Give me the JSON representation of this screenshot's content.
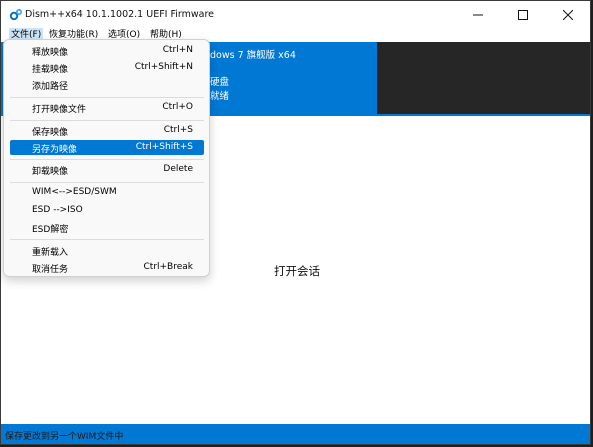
{
  "window": {
    "title": "Dism++x64 10.1.1002.1 UEFI Firmware",
    "app_icon": "gears-icon",
    "controls": [
      "minimize-icon",
      "maximize-icon",
      "close-icon"
    ]
  },
  "menubar": {
    "items": [
      {
        "label": "文件(F)"
      },
      {
        "label": "恢复功能(R)"
      },
      {
        "label": "选项(O)"
      },
      {
        "label": "帮助(H)"
      }
    ]
  },
  "header": {
    "os_name": "dows 7 旗舰版 x64",
    "drive": "硬盘",
    "status": "就绪"
  },
  "main": {
    "center_text": "打开会话"
  },
  "file_menu": {
    "groups": [
      [
        {
          "label": "释放映像",
          "shortcut": "Ctrl+N"
        },
        {
          "label": "挂载映像",
          "shortcut": "Ctrl+Shift+N"
        },
        {
          "label": "添加路径",
          "shortcut": ""
        }
      ],
      [
        {
          "label": "打开映像文件",
          "shortcut": "Ctrl+O"
        }
      ],
      [
        {
          "label": "保存映像",
          "shortcut": "Ctrl+S"
        },
        {
          "label": "另存为映像",
          "shortcut": "Ctrl+Shift+S"
        }
      ],
      [
        {
          "label": "卸载映像",
          "shortcut": "Delete"
        }
      ],
      [
        {
          "label": "WIM<-->ESD/SWM",
          "shortcut": ""
        },
        {
          "label": "ESD -->ISO",
          "shortcut": ""
        },
        {
          "label": "ESD解密",
          "shortcut": ""
        }
      ],
      [
        {
          "label": "重新载入",
          "shortcut": ""
        },
        {
          "label": "取消任务",
          "shortcut": "Ctrl+Break"
        }
      ]
    ],
    "highlighted": "另存为映像"
  },
  "statusbar": {
    "text": "保存更改到另一个WIM文件中"
  },
  "colors": {
    "accent": "#0078d4",
    "dark_panel": "#262626",
    "menu_bg": "#f9f9f9"
  }
}
